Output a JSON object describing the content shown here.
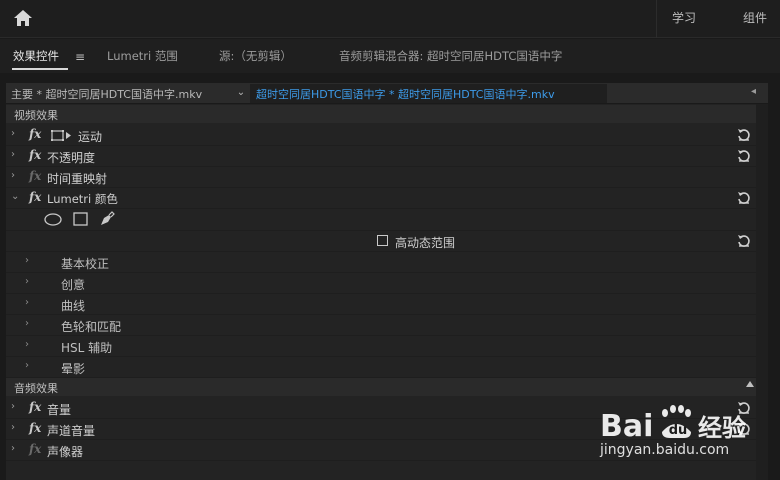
{
  "topbar": {
    "learn": "学习",
    "assemble": "组件"
  },
  "tabs": {
    "effects": "效果控件",
    "lumetri_scope": "Lumetri 范围",
    "source": "源:（无剪辑）",
    "mixer": "音频剪辑混合器: 超时空同居HDTC国语中字"
  },
  "clipbar": {
    "master": "主要 * 超时空同居HDTC国语中字.mkv",
    "sequence": "超时空同居HDTC国语中字 * 超时空同居HDTC国语中字.mkv",
    "seq_color": "#3d9be9"
  },
  "video_section": "视频效果",
  "video_effects": [
    {
      "label": "运动",
      "fx": "fx",
      "chev": "›",
      "reset": true
    },
    {
      "label": "不透明度",
      "fx": "fx",
      "chev": "›",
      "reset": true
    },
    {
      "label": "时间重映射",
      "fx": "fx",
      "chev": "›",
      "reset": false
    },
    {
      "label": "Lumetri 颜色",
      "fx": "fx",
      "chev": "⌄",
      "reset": true
    }
  ],
  "hdr_label": "高动态范围",
  "lumetri_sub": [
    "基本校正",
    "创意",
    "曲线",
    "色轮和匹配",
    "HSL 辅助",
    "晕影"
  ],
  "audio_section": "音频效果",
  "audio_effects": [
    {
      "label": "音量",
      "fx": "fx",
      "chev": "›",
      "reset": true
    },
    {
      "label": "声道音量",
      "fx": "fx",
      "chev": "›",
      "reset": true
    },
    {
      "label": "声像器",
      "fx": "fx",
      "chev": "›",
      "reset": false
    }
  ],
  "watermark": {
    "brand": "Bai经验",
    "url": "jingyan.baidu.com"
  }
}
